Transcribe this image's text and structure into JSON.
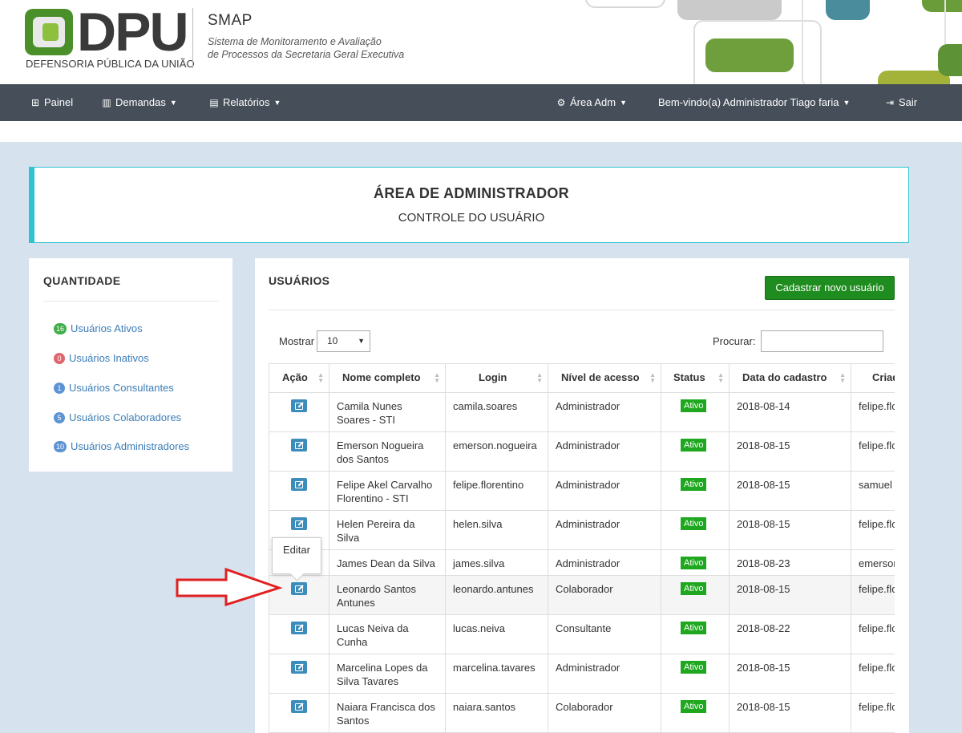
{
  "header": {
    "logo_text": "DPU",
    "logo_subtitle": "DEFENSORIA PÚBLICA DA UNIÃO",
    "app_name": "SMAP",
    "app_description_line1": "Sistema de Monitoramento e Avaliação",
    "app_description_line2": "de Processos da Secretaria Geral Executiva"
  },
  "nav": {
    "painel": "Painel",
    "demandas": "Demandas",
    "relatorios": "Relatórios",
    "area_adm": "Área Adm",
    "welcome": "Bem-vindo(a) Administrador Tiago faria",
    "sair": "Sair"
  },
  "page": {
    "title": "ÁREA DE ADMINISTRADOR",
    "subtitle": "CONTROLE DO USUÁRIO"
  },
  "quantity": {
    "title": "QUANTIDADE",
    "items": [
      {
        "count": "16",
        "label": "Usuários Ativos",
        "color": "#3fae49"
      },
      {
        "count": "0",
        "label": "Usuários Inativos",
        "color": "#e0656d"
      },
      {
        "count": "1",
        "label": "Usuários Consultantes",
        "color": "#5b93d3"
      },
      {
        "count": "5",
        "label": "Usuários Colaboradores",
        "color": "#5b93d3"
      },
      {
        "count": "10",
        "label": "Usuários Administradores",
        "color": "#5b93d3"
      }
    ]
  },
  "users": {
    "title": "USUÁRIOS",
    "new_button": "Cadastrar novo usuário",
    "show_label": "Mostrar",
    "show_value": "10",
    "search_label": "Procurar:",
    "search_value": "",
    "columns": [
      "Ação",
      "Nome completo",
      "Login",
      "Nível de acesso",
      "Status",
      "Data do cadastro",
      "Criado por"
    ],
    "rows": [
      {
        "name": "Camila Nunes Soares - STI",
        "login": "camila.soares",
        "level": "Administrador",
        "status": "Ativo",
        "date": "2018-08-14",
        "created_by": "felipe.florentino"
      },
      {
        "name": "Emerson Nogueira dos Santos",
        "login": "emerson.nogueira",
        "level": "Administrador",
        "status": "Ativo",
        "date": "2018-08-15",
        "created_by": "felipe.florentino"
      },
      {
        "name": "Felipe Akel Carvalho Florentino - STI",
        "login": "felipe.florentino",
        "level": "Administrador",
        "status": "Ativo",
        "date": "2018-08-15",
        "created_by": "samuel"
      },
      {
        "name": "Helen Pereira da Silva",
        "login": "helen.silva",
        "level": "Administrador",
        "status": "Ativo",
        "date": "2018-08-15",
        "created_by": "felipe.florentino"
      },
      {
        "name": "James Dean da Silva",
        "login": "james.silva",
        "level": "Administrador",
        "status": "Ativo",
        "date": "2018-08-23",
        "created_by": "emerson.nogueira"
      },
      {
        "name": "Leonardo Santos Antunes",
        "login": "leonardo.antunes",
        "level": "Colaborador",
        "status": "Ativo",
        "date": "2018-08-15",
        "created_by": "felipe.florentino"
      },
      {
        "name": "Lucas Neiva da Cunha",
        "login": "lucas.neiva",
        "level": "Consultante",
        "status": "Ativo",
        "date": "2018-08-22",
        "created_by": "felipe.florentino"
      },
      {
        "name": "Marcelina Lopes da Silva Tavares",
        "login": "marcelina.tavares",
        "level": "Administrador",
        "status": "Ativo",
        "date": "2018-08-15",
        "created_by": "felipe.florentino"
      },
      {
        "name": "Naiara Francisca dos Santos",
        "login": "naiara.santos",
        "level": "Colaborador",
        "status": "Ativo",
        "date": "2018-08-15",
        "created_by": "felipe.florentino"
      }
    ]
  },
  "tooltip": {
    "text": "Editar"
  },
  "colors": {
    "navbar": "#454e59",
    "accent_cyan": "#2fc4d0",
    "primary_green": "#1f8c1f",
    "status_green": "#1fa81f",
    "edit_blue": "#3c8dbc"
  }
}
